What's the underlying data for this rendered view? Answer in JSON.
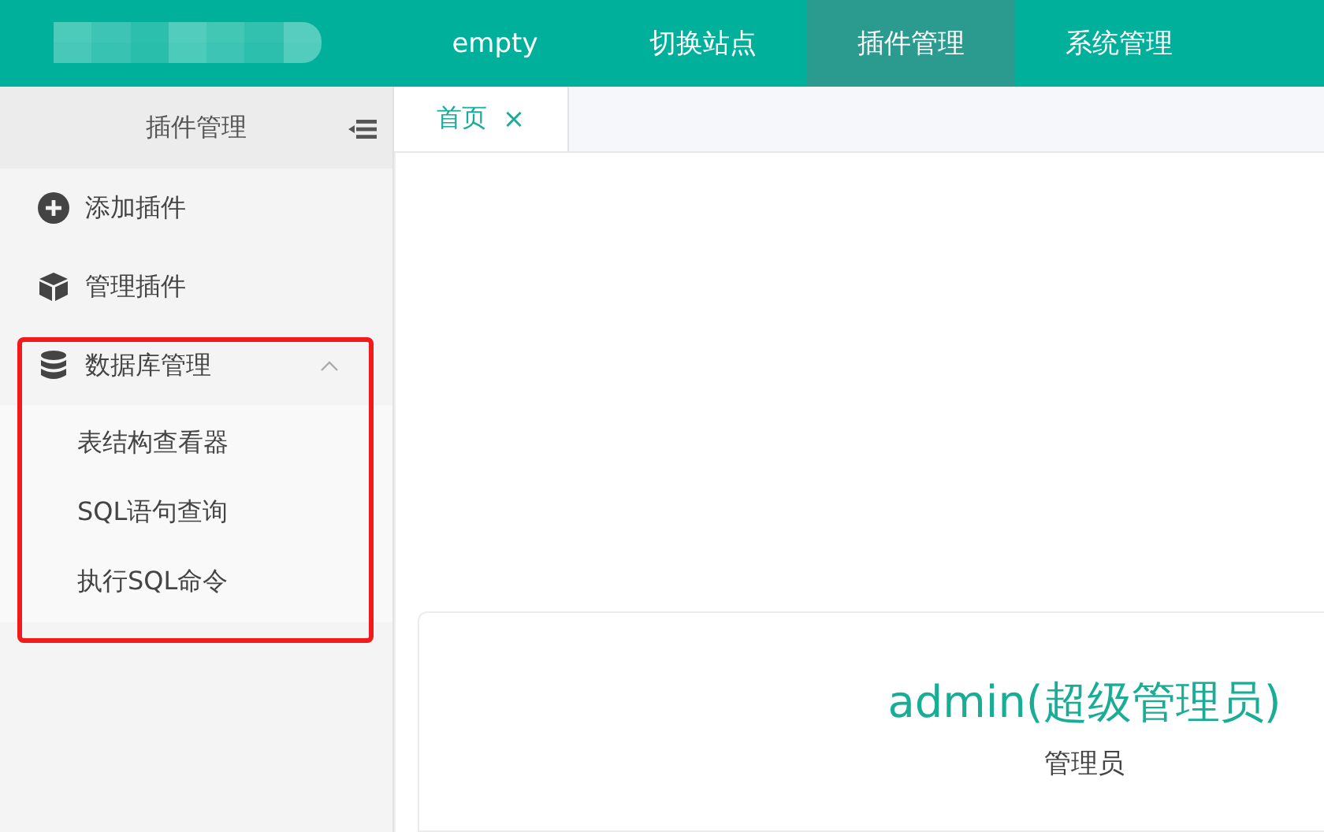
{
  "nav": [
    {
      "label": "empty",
      "selected": false
    },
    {
      "label": "切换站点",
      "selected": false
    },
    {
      "label": "插件管理",
      "selected": true
    },
    {
      "label": "系统管理",
      "selected": false
    }
  ],
  "sidebar": {
    "title": "插件管理",
    "items": [
      {
        "label": "添加插件"
      },
      {
        "label": "管理插件"
      },
      {
        "label": "数据库管理",
        "expanded": true,
        "children": [
          {
            "label": "表结构查看器"
          },
          {
            "label": "SQL语句查询"
          },
          {
            "label": "执行SQL命令"
          }
        ]
      }
    ]
  },
  "tabs": [
    {
      "label": "首页",
      "close": "×",
      "selected": true
    }
  ],
  "profile": {
    "name": "admin(超级管理员)",
    "role": "管理员"
  }
}
